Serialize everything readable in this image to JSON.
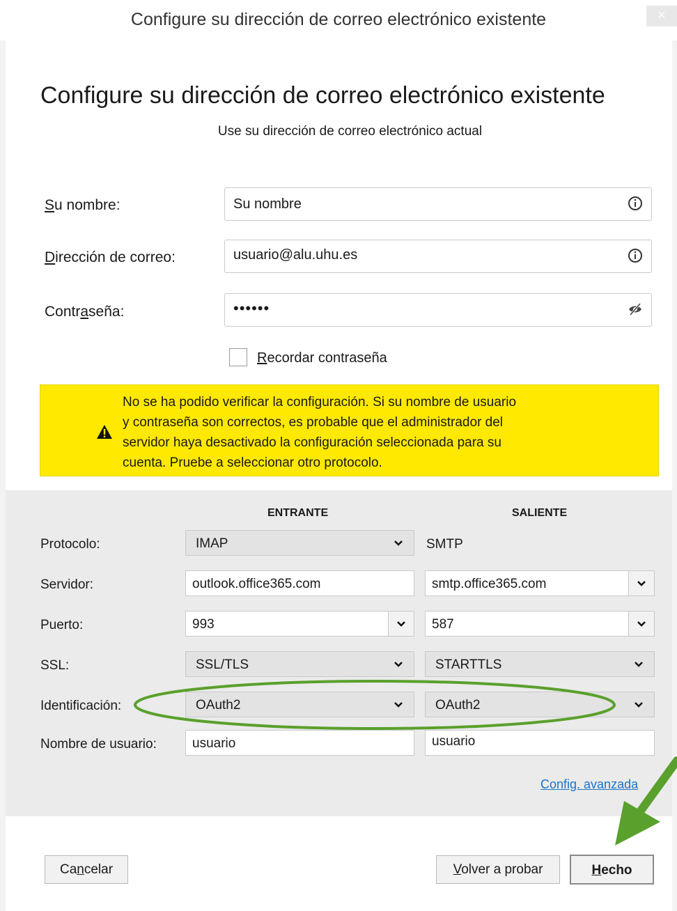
{
  "window": {
    "title": "Configure su dirección de correo electrónico existente",
    "close_label": "×"
  },
  "header": {
    "title": "Configure su dirección de correo electrónico existente",
    "subtitle": "Use su dirección de correo electrónico actual"
  },
  "form": {
    "name_label": "Su nombre:",
    "name_value": "Su nombre",
    "email_label": "Dirección de correo:",
    "email_value": "usuario@alu.uhu.es",
    "password_label": "Contraseña:",
    "password_value": "••••••",
    "remember_label": "Recordar contraseña",
    "remember_checked": false
  },
  "warning": {
    "lines": [
      "No se ha podido verificar la configuración. Si su nombre de usuario",
      "y contraseña son correctos, es probable que el administrador del",
      "servidor haya desactivado la configuración seleccionada para su",
      "cuenta. Pruebe a seleccionar otro protocolo."
    ]
  },
  "settings": {
    "incoming_header": "ENTRANTE",
    "outgoing_header": "SALIENTE",
    "rows": {
      "protocol": {
        "label": "Protocolo:",
        "incoming": "IMAP",
        "outgoing": "SMTP"
      },
      "server": {
        "label": "Servidor:",
        "incoming": "outlook.office365.com",
        "outgoing": "smtp.office365.com"
      },
      "port": {
        "label": "Puerto:",
        "incoming": "993",
        "outgoing": "587"
      },
      "ssl": {
        "label": "SSL:",
        "incoming": "SSL/TLS",
        "outgoing": "STARTTLS"
      },
      "auth": {
        "label": "Identificación:",
        "incoming": "OAuth2",
        "outgoing": "OAuth2"
      },
      "username": {
        "label": "Nombre de usuario:",
        "incoming": "usuario",
        "outgoing": "usuario"
      }
    },
    "advanced_link": "Config. avanzada"
  },
  "buttons": {
    "cancel": "Cancelar",
    "retry": "Volver a probar",
    "done": "Hecho"
  },
  "colors": {
    "warning_bg": "#ffe900",
    "annotation": "#5aa02c",
    "link": "#1a73c9"
  }
}
